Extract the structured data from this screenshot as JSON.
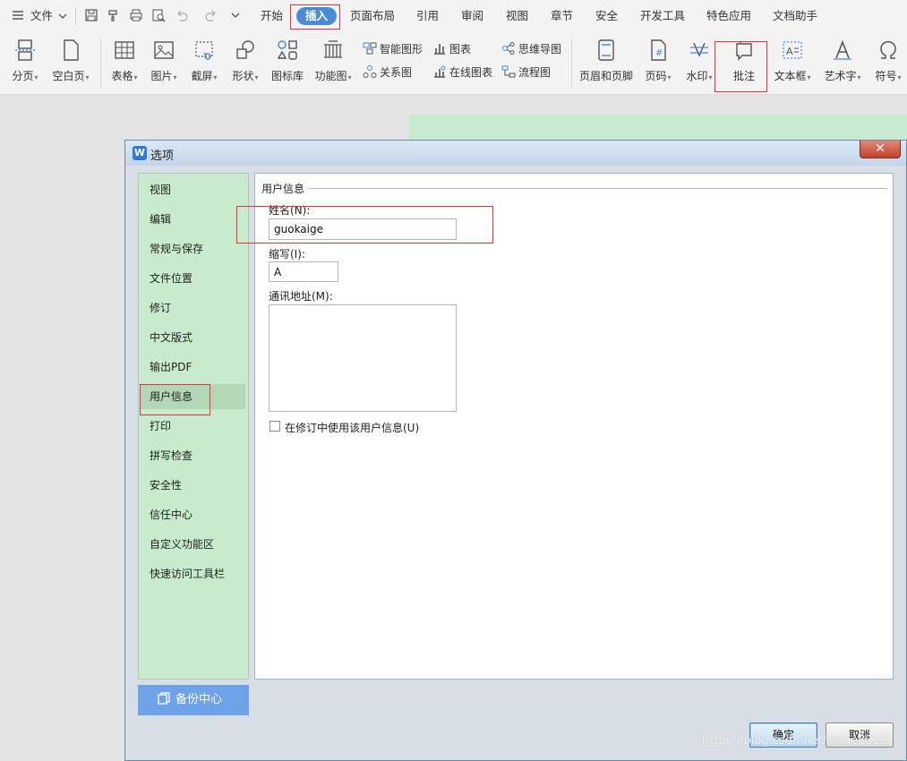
{
  "menubar": {
    "file_label": "文件",
    "tabs": [
      {
        "label": "开始"
      },
      {
        "label": "插入"
      },
      {
        "label": "页面布局"
      },
      {
        "label": "引用"
      },
      {
        "label": "审阅"
      },
      {
        "label": "视图"
      },
      {
        "label": "章节"
      },
      {
        "label": "安全"
      },
      {
        "label": "开发工具"
      },
      {
        "label": "特色应用"
      },
      {
        "label": "文档助手"
      }
    ],
    "active_tab": "插入"
  },
  "ribbon": {
    "page_break": "分页",
    "blank_page": "空白页",
    "table": "表格",
    "picture": "图片",
    "screenshot": "截屏",
    "shape": "形状",
    "icon_library": "图标库",
    "function_chart": "功能图",
    "smart_graphic": "智能图形",
    "relation_chart": "关系图",
    "chart": "图表",
    "online_chart": "在线图表",
    "mind_map": "思维导图",
    "flowchart": "流程图",
    "header_footer": "页眉和页脚",
    "page_number": "页码",
    "watermark": "水印",
    "comment": "批注",
    "text_box": "文本框",
    "word_art": "艺术字",
    "symbol": "符号"
  },
  "dialog": {
    "title": "选项",
    "logo_letter": "W",
    "nav_items": [
      {
        "label": "视图"
      },
      {
        "label": "编辑"
      },
      {
        "label": "常规与保存"
      },
      {
        "label": "文件位置"
      },
      {
        "label": "修订"
      },
      {
        "label": "中文版式"
      },
      {
        "label": "输出PDF"
      },
      {
        "label": "用户信息"
      },
      {
        "label": "打印"
      },
      {
        "label": "拼写检查"
      },
      {
        "label": "安全性"
      },
      {
        "label": "信任中心"
      },
      {
        "label": "自定义功能区"
      },
      {
        "label": "快速访问工具栏"
      }
    ],
    "selected_nav": "用户信息",
    "backup_label": "备份中心",
    "user_info": {
      "group_title": "用户信息",
      "name_label": "姓名(N):",
      "name_value": "guokaige",
      "initials_label": "缩写(I):",
      "initials_value": "A",
      "address_label": "通讯地址(M):",
      "address_value": "",
      "use_in_revision_label": "在修订中使用该用户信息(U)",
      "use_in_revision_checked": false
    },
    "ok_label": "确定",
    "cancel_label": "取消"
  },
  "watermark_text": "https://blog.csdn.net/kaige8312"
}
